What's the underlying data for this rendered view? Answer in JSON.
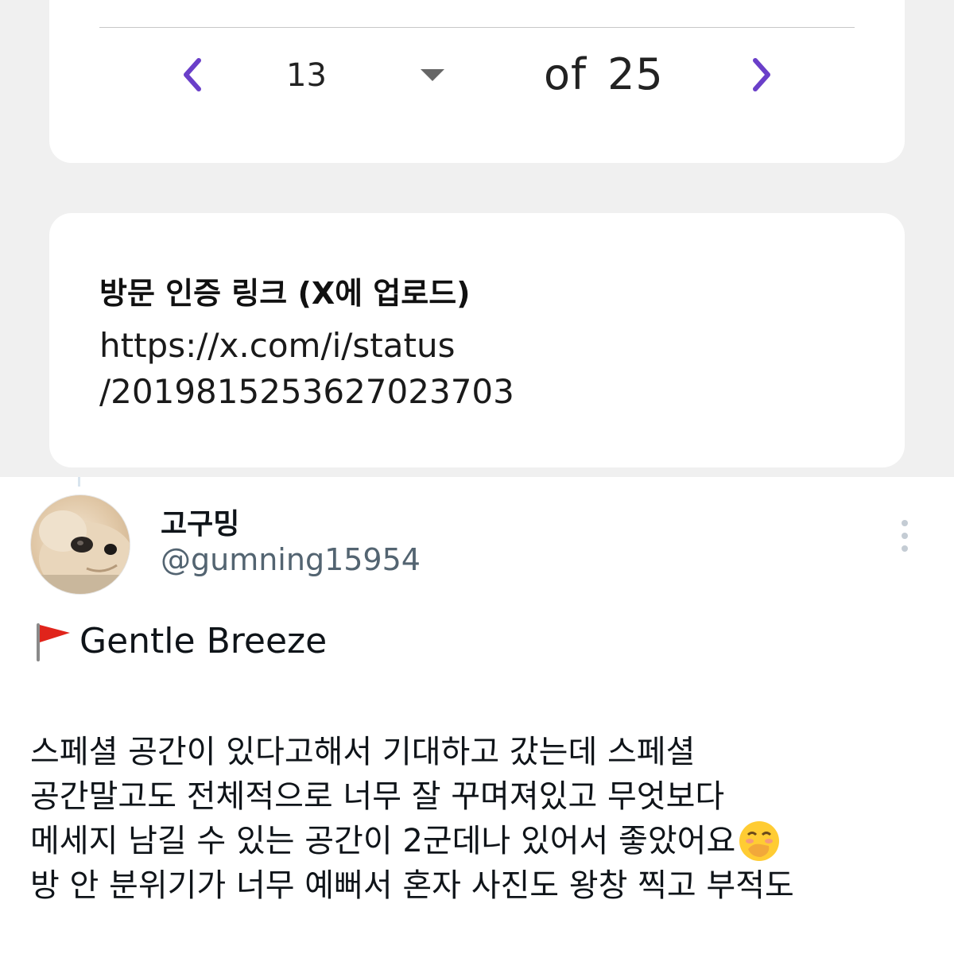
{
  "pager": {
    "current_page": "13",
    "of_label": "of",
    "total_pages": "25",
    "accent_color": "#6a3fc9"
  },
  "link_card": {
    "title": "방문 인증 링크 (X에 업로드)",
    "url_line1": "https://x.com/i/status",
    "url_line2": "/2019815253627023703"
  },
  "tweet": {
    "display_name": "고구밍",
    "handle": "@gumning15954",
    "heading": "Gentle Breeze",
    "heading_icon": "red-flag-icon",
    "body_lines": [
      "스페셜 공간이 있다고해서 기대하고 갔는데 스페셜",
      "공간말고도 전체적으로 너무 잘 꾸며져있고 무엇보다",
      "메세지 남길 수 있는 공간이 2군데나 있어서 좋았어요",
      "방 안 분위기가 너무 예뻐서 혼자 사진도 왕창 찍고 부적도"
    ],
    "line3_emoji": "face-with-hand-over-mouth-icon"
  }
}
